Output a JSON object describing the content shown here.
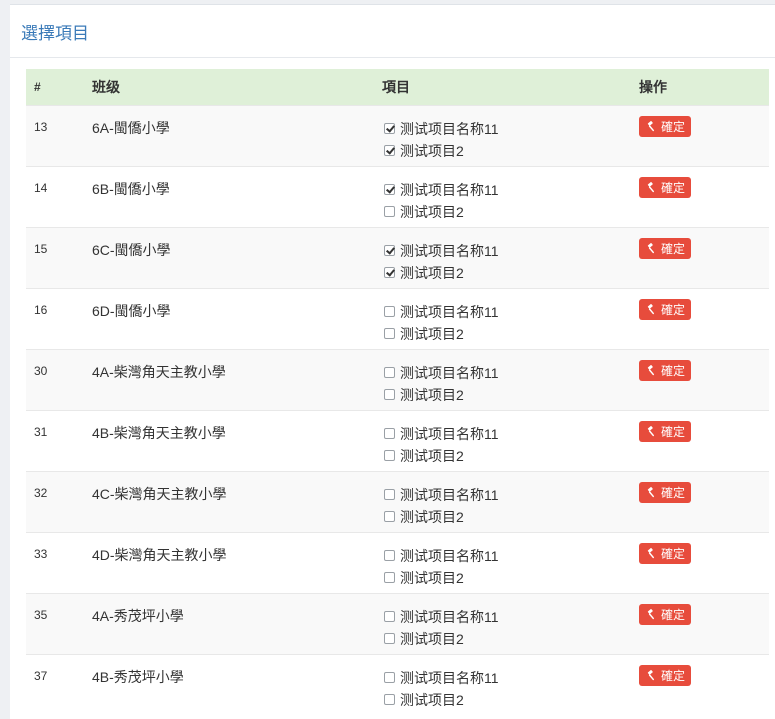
{
  "panel": {
    "title": "選擇項目"
  },
  "table": {
    "headers": {
      "idx": "#",
      "name": "班级",
      "items": "項目",
      "ops": "操作"
    },
    "rows": [
      {
        "idx": "13",
        "name": "6A-閩僑小學",
        "items": [
          {
            "label": "测试项目名称11",
            "checked": true
          },
          {
            "label": "测试项目2",
            "checked": true
          }
        ],
        "button": "確定"
      },
      {
        "idx": "14",
        "name": "6B-閩僑小學",
        "items": [
          {
            "label": "测试项目名称11",
            "checked": true
          },
          {
            "label": "测试项目2",
            "checked": false
          }
        ],
        "button": "確定"
      },
      {
        "idx": "15",
        "name": "6C-閩僑小學",
        "items": [
          {
            "label": "测试项目名称11",
            "checked": true
          },
          {
            "label": "测试项目2",
            "checked": true
          }
        ],
        "button": "確定"
      },
      {
        "idx": "16",
        "name": "6D-閩僑小學",
        "items": [
          {
            "label": "测试项目名称11",
            "checked": false
          },
          {
            "label": "测试项目2",
            "checked": false
          }
        ],
        "button": "確定"
      },
      {
        "idx": "30",
        "name": "4A-柴灣角天主教小學",
        "items": [
          {
            "label": "测试项目名称11",
            "checked": false
          },
          {
            "label": "测试项目2",
            "checked": false
          }
        ],
        "button": "確定"
      },
      {
        "idx": "31",
        "name": "4B-柴灣角天主教小學",
        "items": [
          {
            "label": "测试项目名称11",
            "checked": false
          },
          {
            "label": "测试项目2",
            "checked": false
          }
        ],
        "button": "確定"
      },
      {
        "idx": "32",
        "name": "4C-柴灣角天主教小學",
        "items": [
          {
            "label": "测试项目名称11",
            "checked": false
          },
          {
            "label": "测试项目2",
            "checked": false
          }
        ],
        "button": "確定"
      },
      {
        "idx": "33",
        "name": "4D-柴灣角天主教小學",
        "items": [
          {
            "label": "测试项目名称11",
            "checked": false
          },
          {
            "label": "测试项目2",
            "checked": false
          }
        ],
        "button": "確定"
      },
      {
        "idx": "35",
        "name": "4A-秀茂坪小學",
        "items": [
          {
            "label": "测试项目名称11",
            "checked": false
          },
          {
            "label": "测试项目2",
            "checked": false
          }
        ],
        "button": "確定"
      },
      {
        "idx": "37",
        "name": "4B-秀茂坪小學",
        "items": [
          {
            "label": "测试项目名称11",
            "checked": false
          },
          {
            "label": "测试项目2",
            "checked": false
          }
        ],
        "button": "確定"
      }
    ]
  },
  "icons": {
    "button_icon": "gavel-icon"
  },
  "colors": {
    "header_bg": "#dff0d8",
    "button_bg": "#e74c3c",
    "title_color": "#3a7ab8"
  }
}
